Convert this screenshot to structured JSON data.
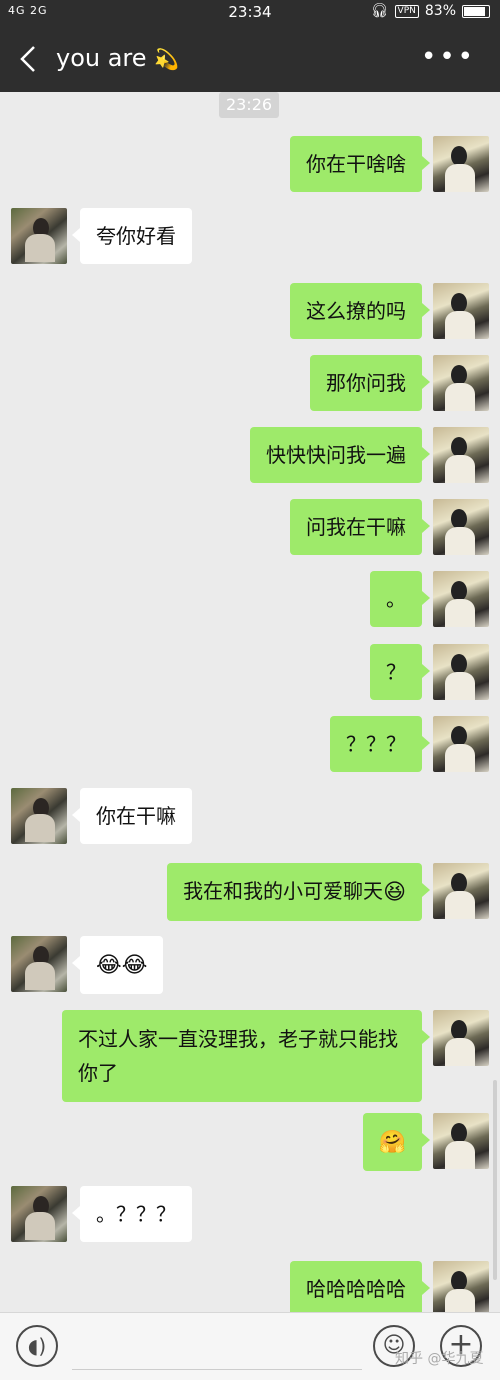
{
  "status_bar": {
    "signal": "4G 2G",
    "time": "23:34",
    "vpn": "VPN",
    "battery": "83%"
  },
  "header": {
    "title": "you are",
    "title_emoji": "💫",
    "more_icon": "more-icon"
  },
  "chat": {
    "timestamp": "23:26",
    "messages": [
      {
        "from": "me",
        "text": "你在干啥啥"
      },
      {
        "from": "them",
        "text": "夸你好看"
      },
      {
        "from": "me",
        "text": "这么撩的吗"
      },
      {
        "from": "me",
        "text": "那你问我"
      },
      {
        "from": "me",
        "text": "快快快问我一遍"
      },
      {
        "from": "me",
        "text": "问我在干嘛"
      },
      {
        "from": "me",
        "text": "。"
      },
      {
        "from": "me",
        "text": "？"
      },
      {
        "from": "me",
        "text": "？？？"
      },
      {
        "from": "them",
        "text": "你在干嘛"
      },
      {
        "from": "me",
        "text": "我在和我的小可爱聊天",
        "emoji": "😆"
      },
      {
        "from": "them",
        "text": "",
        "emoji": "😂😂"
      },
      {
        "from": "me",
        "text": "不过人家一直没理我，老子就只能找你了"
      },
      {
        "from": "me",
        "text": "",
        "emoji": "🤗"
      },
      {
        "from": "them",
        "text": "。？？？"
      },
      {
        "from": "me",
        "text": "哈哈哈哈哈"
      }
    ]
  },
  "input_bar": {
    "voice_icon": "voice-icon",
    "emoji_icon": "emoji-icon",
    "plus_icon": "plus-icon"
  },
  "watermark": "知乎 @华九夏",
  "colors": {
    "header_bg": "#2e2e2e",
    "chat_bg": "#ebebeb",
    "my_bubble": "#9eea6a",
    "their_bubble": "#ffffff"
  }
}
